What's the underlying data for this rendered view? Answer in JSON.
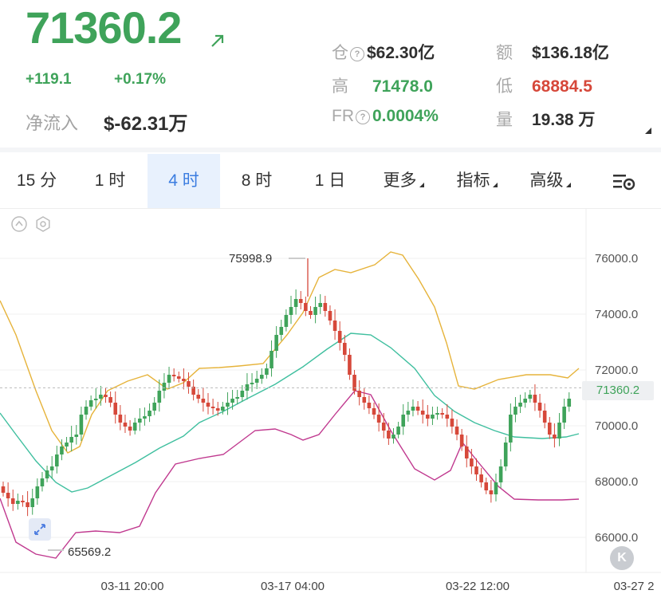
{
  "header": {
    "price": "71360.2",
    "change_abs": "+119.1",
    "change_pct": "+0.17%",
    "netflow_label": "净流入",
    "netflow_value": "$-62.31万",
    "stats": {
      "oi_label": "仓",
      "oi_value": "$62.30亿",
      "amount_label": "额",
      "amount_value": "$136.18亿",
      "high_label": "高",
      "high_value": "71478.0",
      "low_label": "低",
      "low_value": "68884.5",
      "fr_label": "FR",
      "fr_value": "0.0004%",
      "vol_label": "量",
      "vol_value": "19.38 万"
    },
    "help_glyph": "?"
  },
  "tabs": [
    {
      "label": "15 分"
    },
    {
      "label": "1 时"
    },
    {
      "label": "4 时",
      "active": true
    },
    {
      "label": "8 时"
    },
    {
      "label": "1 日"
    },
    {
      "label": "更多"
    },
    {
      "label": "指标"
    },
    {
      "label": "高级"
    }
  ],
  "chart": {
    "y_ticks": [
      "76000.0",
      "74000.0",
      "72000.0",
      "70000.0",
      "68000.0",
      "66000.0"
    ],
    "x_ticks": [
      "03-11 20:00",
      "03-17 04:00",
      "03-22 12:00",
      "03-27 2"
    ],
    "last_price": "71360.2",
    "high_mark": "75998.9",
    "low_mark": "65569.2",
    "k_button": "K"
  },
  "colors": {
    "up": "#3fa35a",
    "down": "#d6483a",
    "accent": "#3b7de0",
    "ma_upper": "#e6b33a",
    "ma_mid": "#3fbf9f",
    "ma_lower": "#c0398f"
  },
  "icons": [
    "arrow-up-right-icon",
    "help-circle-icon",
    "settings-icon",
    "collapse-icon",
    "gear-icon",
    "expand-icon"
  ]
}
